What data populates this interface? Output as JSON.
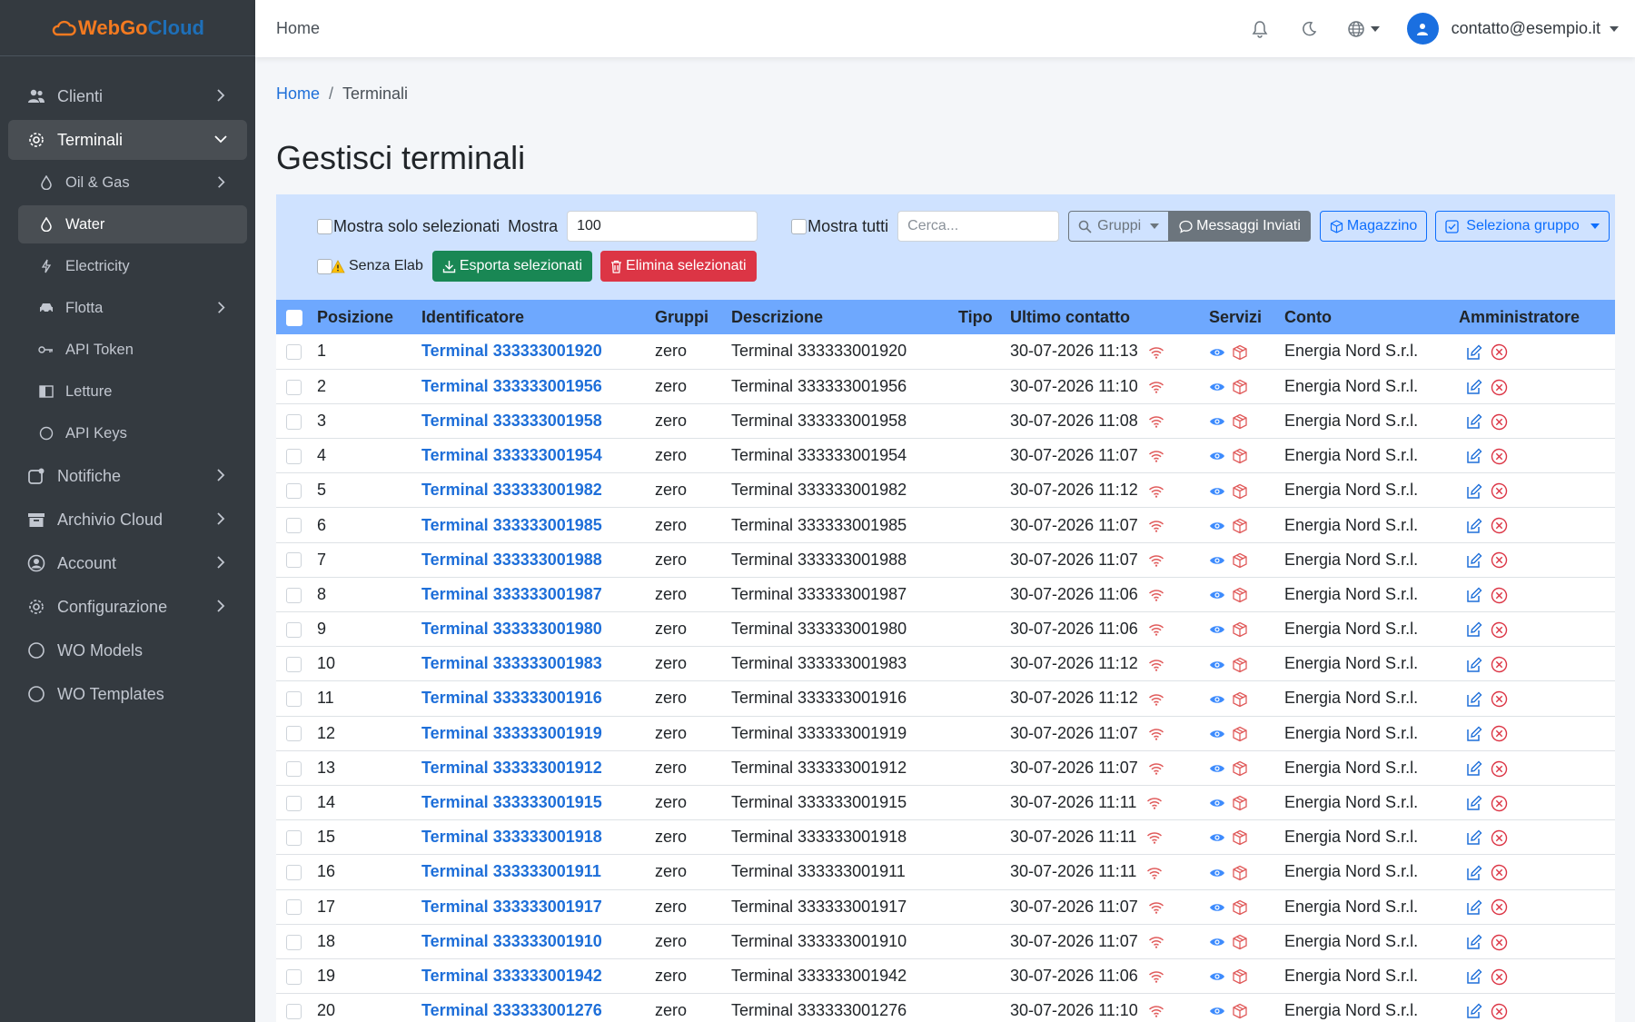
{
  "brand": {
    "part1": "WebGo",
    "part2": "Cloud"
  },
  "sidebar": {
    "items": [
      {
        "label": "Clienti",
        "icon": "users-icon",
        "expandable": true
      },
      {
        "label": "Terminali",
        "icon": "gear-icon",
        "expandable": true,
        "active": true
      },
      {
        "label": "Notifiche",
        "icon": "notification-icon",
        "expandable": true
      },
      {
        "label": "Archivio Cloud",
        "icon": "archive-icon",
        "expandable": true
      },
      {
        "label": "Account",
        "icon": "user-circle-icon",
        "expandable": true
      },
      {
        "label": "Configurazione",
        "icon": "gear-icon",
        "expandable": true
      },
      {
        "label": "WO Models",
        "icon": "circle-icon",
        "expandable": false
      },
      {
        "label": "WO Templates",
        "icon": "circle-icon",
        "expandable": false
      }
    ],
    "sub_items": [
      {
        "label": "Oil & Gas",
        "icon": "drop-icon",
        "expandable": true
      },
      {
        "label": "Water",
        "icon": "drop-icon",
        "active": true
      },
      {
        "label": "Electricity",
        "icon": "bolt-icon"
      },
      {
        "label": "Flotta",
        "icon": "car-icon",
        "expandable": true
      },
      {
        "label": "API Token",
        "icon": "key-icon"
      },
      {
        "label": "Letture",
        "icon": "book-icon"
      },
      {
        "label": "API Keys",
        "icon": "circle-icon"
      }
    ]
  },
  "topbar": {
    "home_label": "Home",
    "user_email": "contatto@esempio.it"
  },
  "breadcrumb": {
    "home": "Home",
    "separator": "/",
    "current": "Terminali"
  },
  "page_title": "Gestisci terminali",
  "filters": {
    "show_selected_label": "Mostra solo selezionati",
    "show_label": "Mostra",
    "show_value": "100",
    "show_all_label": "Mostra tutti",
    "search_placeholder": "Cerca...",
    "groups_label": "Gruppi",
    "sent_messages_label": "Messaggi Inviati",
    "warehouse_label": "Magazzino",
    "select_group_label": "Seleziona gruppo",
    "no_elab_label": "Senza Elab",
    "export_label": "Esporta selezionati",
    "delete_label": "Elimina selezionati"
  },
  "table": {
    "headers": [
      "Posizione",
      "Identificatore",
      "Gruppi",
      "Descrizione",
      "Tipo",
      "Ultimo contatto",
      "Servizi",
      "Conto",
      "Amministratore"
    ],
    "rows": [
      {
        "pos": "1",
        "id": "Terminal 333333001920",
        "group": "zero",
        "desc": "Terminal 333333001920",
        "tipo": "",
        "last": "30-07-2026 11:13",
        "conto": "Energia Nord S.r.l."
      },
      {
        "pos": "2",
        "id": "Terminal 333333001956",
        "group": "zero",
        "desc": "Terminal 333333001956",
        "tipo": "",
        "last": "30-07-2026 11:10",
        "conto": "Energia Nord S.r.l."
      },
      {
        "pos": "3",
        "id": "Terminal 333333001958",
        "group": "zero",
        "desc": "Terminal 333333001958",
        "tipo": "",
        "last": "30-07-2026 11:08",
        "conto": "Energia Nord S.r.l."
      },
      {
        "pos": "4",
        "id": "Terminal 333333001954",
        "group": "zero",
        "desc": "Terminal 333333001954",
        "tipo": "",
        "last": "30-07-2026 11:07",
        "conto": "Energia Nord S.r.l."
      },
      {
        "pos": "5",
        "id": "Terminal 333333001982",
        "group": "zero",
        "desc": "Terminal 333333001982",
        "tipo": "",
        "last": "30-07-2026 11:12",
        "conto": "Energia Nord S.r.l."
      },
      {
        "pos": "6",
        "id": "Terminal 333333001985",
        "group": "zero",
        "desc": "Terminal 333333001985",
        "tipo": "",
        "last": "30-07-2026 11:07",
        "conto": "Energia Nord S.r.l."
      },
      {
        "pos": "7",
        "id": "Terminal 333333001988",
        "group": "zero",
        "desc": "Terminal 333333001988",
        "tipo": "",
        "last": "30-07-2026 11:07",
        "conto": "Energia Nord S.r.l."
      },
      {
        "pos": "8",
        "id": "Terminal 333333001987",
        "group": "zero",
        "desc": "Terminal 333333001987",
        "tipo": "",
        "last": "30-07-2026 11:06",
        "conto": "Energia Nord S.r.l."
      },
      {
        "pos": "9",
        "id": "Terminal 333333001980",
        "group": "zero",
        "desc": "Terminal 333333001980",
        "tipo": "",
        "last": "30-07-2026 11:06",
        "conto": "Energia Nord S.r.l."
      },
      {
        "pos": "10",
        "id": "Terminal 333333001983",
        "group": "zero",
        "desc": "Terminal 333333001983",
        "tipo": "",
        "last": "30-07-2026 11:12",
        "conto": "Energia Nord S.r.l."
      },
      {
        "pos": "11",
        "id": "Terminal 333333001916",
        "group": "zero",
        "desc": "Terminal 333333001916",
        "tipo": "",
        "last": "30-07-2026 11:12",
        "conto": "Energia Nord S.r.l."
      },
      {
        "pos": "12",
        "id": "Terminal 333333001919",
        "group": "zero",
        "desc": "Terminal 333333001919",
        "tipo": "",
        "last": "30-07-2026 11:07",
        "conto": "Energia Nord S.r.l."
      },
      {
        "pos": "13",
        "id": "Terminal 333333001912",
        "group": "zero",
        "desc": "Terminal 333333001912",
        "tipo": "",
        "last": "30-07-2026 11:07",
        "conto": "Energia Nord S.r.l."
      },
      {
        "pos": "14",
        "id": "Terminal 333333001915",
        "group": "zero",
        "desc": "Terminal 333333001915",
        "tipo": "",
        "last": "30-07-2026 11:11",
        "conto": "Energia Nord S.r.l."
      },
      {
        "pos": "15",
        "id": "Terminal 333333001918",
        "group": "zero",
        "desc": "Terminal 333333001918",
        "tipo": "",
        "last": "30-07-2026 11:11",
        "conto": "Energia Nord S.r.l."
      },
      {
        "pos": "16",
        "id": "Terminal 333333001911",
        "group": "zero",
        "desc": "Terminal 333333001911",
        "tipo": "",
        "last": "30-07-2026 11:11",
        "conto": "Energia Nord S.r.l."
      },
      {
        "pos": "17",
        "id": "Terminal 333333001917",
        "group": "zero",
        "desc": "Terminal 333333001917",
        "tipo": "",
        "last": "30-07-2026 11:07",
        "conto": "Energia Nord S.r.l."
      },
      {
        "pos": "18",
        "id": "Terminal 333333001910",
        "group": "zero",
        "desc": "Terminal 333333001910",
        "tipo": "",
        "last": "30-07-2026 11:07",
        "conto": "Energia Nord S.r.l."
      },
      {
        "pos": "19",
        "id": "Terminal 333333001942",
        "group": "zero",
        "desc": "Terminal 333333001942",
        "tipo": "",
        "last": "30-07-2026 11:06",
        "conto": "Energia Nord S.r.l."
      },
      {
        "pos": "20",
        "id": "Terminal 333333001276",
        "group": "zero",
        "desc": "Terminal 333333001276",
        "tipo": "",
        "last": "30-07-2026 11:10",
        "conto": "Energia Nord S.r.l."
      }
    ]
  },
  "colors": {
    "sidebar_bg": "#343a40",
    "accent": "#1e6fd9",
    "brand_orange": "#f47a20",
    "brand_blue": "#1e6fb8",
    "table_header": "#6ea8fe",
    "filter_panel": "#cfe2ff",
    "signal": "#e05a5a",
    "danger": "#dc3545"
  }
}
